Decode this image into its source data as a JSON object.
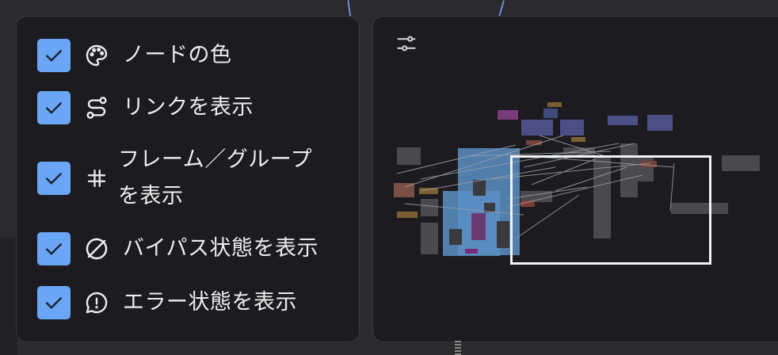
{
  "colors": {
    "accent": "#6aa6f5",
    "panel_bg": "#1c1c20",
    "text": "#ececec",
    "viewport_border": "#f2f2f2"
  },
  "settings_panel": {
    "options": [
      {
        "label": "ノードの色",
        "icon": "palette-icon",
        "checked": true
      },
      {
        "label": "リンクを表示",
        "icon": "route-icon",
        "checked": true
      },
      {
        "label": "フレーム／グループを表示",
        "icon": "hash-icon",
        "checked": true
      },
      {
        "label": "バイパス状態を表示",
        "icon": "circle-slash-icon",
        "checked": true
      },
      {
        "label": "エラー状態を表示",
        "icon": "message-alert-icon",
        "checked": true
      }
    ]
  },
  "minimap": {
    "settings_icon": "sliders-icon"
  }
}
